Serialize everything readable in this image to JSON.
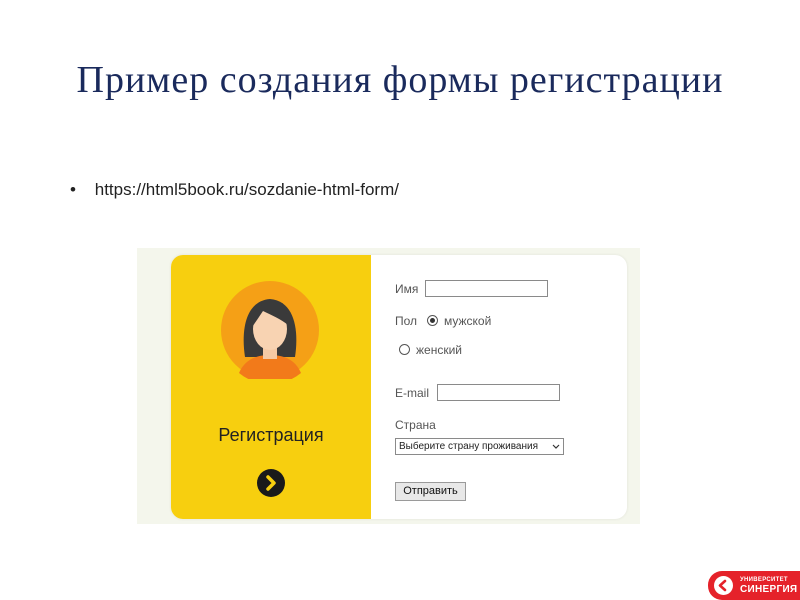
{
  "slide": {
    "title": "Пример создания формы регистрации",
    "bullet_symbol": "•",
    "bullet_link": "https://html5book.ru/sozdanie-html-form/"
  },
  "left_panel": {
    "avatar": "woman-avatar-icon",
    "title": "Регистрация",
    "next_icon": "chevron-right-icon",
    "color": "#f7cf0f"
  },
  "form": {
    "name_label": "Имя",
    "name_value": "",
    "gender_label": "Пол",
    "gender_options": [
      {
        "label": "мужской",
        "checked": true
      },
      {
        "label": "женский",
        "checked": false
      }
    ],
    "email_label": "E-mail",
    "email_value": "",
    "country_label": "Страна",
    "country_selected": "Выберите страну проживания",
    "submit_label": "Отправить"
  },
  "footer_logo": {
    "top_text": "УНИВЕРСИТЕТ",
    "main_text": "СИНЕРГИЯ",
    "color": "#e5222a"
  }
}
